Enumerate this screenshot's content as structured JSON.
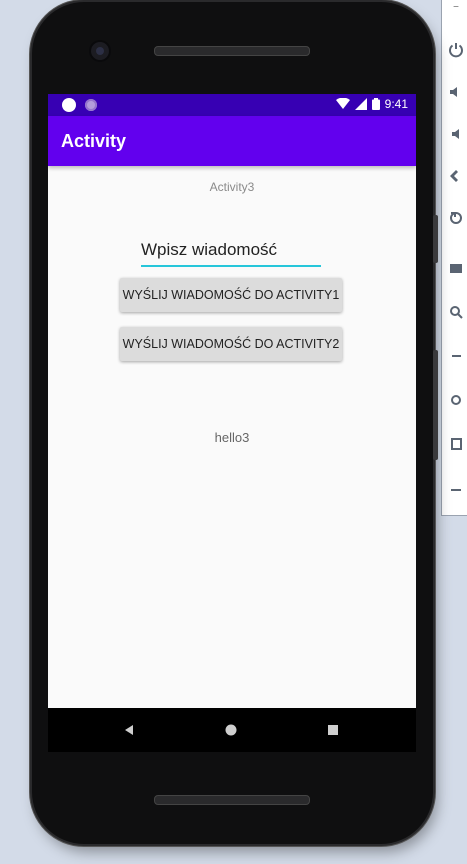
{
  "emulator": {
    "toolbar": {
      "minimize_glyph": "–",
      "icons": [
        "power-icon",
        "volume-up-icon",
        "volume-down-icon",
        "rotate-left-icon",
        "rotate-right-icon",
        "screenshot-icon",
        "zoom-icon",
        "back-icon",
        "home-icon",
        "overview-icon",
        "more-icon"
      ]
    }
  },
  "status_bar": {
    "time": "9:41",
    "background": "#3700b3"
  },
  "app_bar": {
    "title": "Activity",
    "background": "#6200ee"
  },
  "main": {
    "activity_label": "Activity3",
    "message_input": {
      "value": "Wpisz wiadomość",
      "underline_color": "#26c6da"
    },
    "buttons": {
      "send_activity1": "WYŚLIJ WIADOMOŚĆ DO ACTIVITY1",
      "send_activity2": "WYŚLIJ WIADOMOŚĆ DO ACTIVITY2"
    },
    "received_text": "hello3"
  },
  "nav_bar": {
    "icons": [
      "back-icon",
      "home-icon",
      "recents-icon"
    ]
  }
}
